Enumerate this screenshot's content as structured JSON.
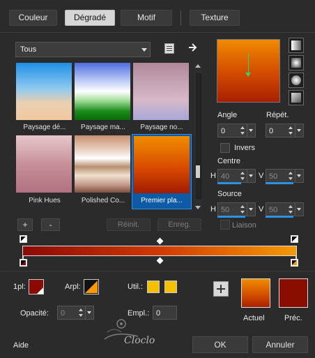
{
  "tabs": [
    {
      "label": "Couleur",
      "active": false
    },
    {
      "label": "Dégradé",
      "active": true
    },
    {
      "label": "Motif",
      "active": false
    },
    {
      "label": "Texture",
      "active": false
    }
  ],
  "category": {
    "selected": "Tous"
  },
  "gradients": [
    {
      "label": "Paysage dé...",
      "selected": false
    },
    {
      "label": "Paysage ma...",
      "selected": false
    },
    {
      "label": "Paysage no...",
      "selected": false
    },
    {
      "label": "Pink Hues",
      "selected": false
    },
    {
      "label": "Polished Co...",
      "selected": false
    },
    {
      "label": "Premier pla...",
      "selected": true
    }
  ],
  "buttons": {
    "add": "+",
    "remove": "-",
    "reset": "Réinit.",
    "save": "Enreg.",
    "ok": "OK",
    "cancel": "Annuler",
    "help": "Aide"
  },
  "properties": {
    "angle_label": "Angle",
    "angle_value": "0",
    "repeat_label": "Répét.",
    "repeat_value": "0",
    "invert_label": "Invers",
    "invert_checked": false,
    "center_label": "Centre",
    "center_h_label": "H",
    "center_h": "40",
    "center_v_label": "V",
    "center_v": "50",
    "source_label": "Source",
    "source_h_label": "H",
    "source_h": "50",
    "source_v_label": "V",
    "source_v": "50",
    "link_label": "Liaison",
    "link_checked": false
  },
  "stops": {
    "pl_label": "1pl:",
    "arpl_label": "Arpl:",
    "util_label": "Util.:",
    "opacity_label": "Opacité:",
    "opacity_value": "0",
    "empl_label": "Empl.:",
    "empl_value": "0"
  },
  "preview": {
    "current_label": "Actuel",
    "previous_label": "Préc.",
    "current_color": "#e57a00",
    "previous_color": "#8a0e00"
  },
  "watermark": "Cloclo",
  "colors": {
    "accent": "#2f8fe0",
    "gradient_start": "#8a0a00",
    "gradient_end": "#f59a00"
  }
}
